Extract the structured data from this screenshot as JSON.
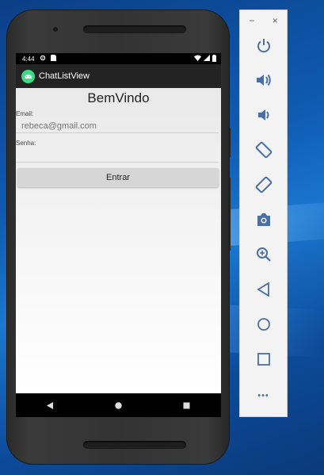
{
  "statusbar": {
    "time": "4:44"
  },
  "app": {
    "title": "ChatListView"
  },
  "form": {
    "heading": "BemVindo",
    "email_label": "Email:",
    "email_value": "rebeca@gmail.com",
    "password_label": "Senha:",
    "password_value": "",
    "submit_label": "Entrar"
  },
  "toolbar": {
    "minimize_label": "−",
    "close_label": "×",
    "more_label": "•••",
    "icons": [
      "power-icon",
      "volume-up-icon",
      "volume-down-icon",
      "rotate-left-icon",
      "rotate-right-icon",
      "camera-icon",
      "zoom-in-icon",
      "back-icon",
      "home-icon",
      "overview-icon",
      "more-icon"
    ]
  },
  "colors": {
    "accent": "#3ddc84",
    "appbar": "#232323",
    "toolbar_icon": "#4a6fa5"
  }
}
